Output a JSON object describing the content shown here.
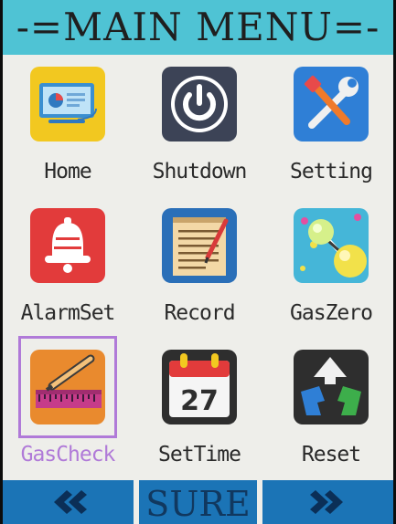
{
  "title": "-=MAIN MENU=-",
  "menu": {
    "items": [
      {
        "label": "Home",
        "icon": "monitor-icon"
      },
      {
        "label": "Shutdown",
        "icon": "power-icon"
      },
      {
        "label": "Setting",
        "icon": "tools-icon"
      },
      {
        "label": "AlarmSet",
        "icon": "bell-icon"
      },
      {
        "label": "Record",
        "icon": "notepad-icon"
      },
      {
        "label": "GasZero",
        "icon": "molecule-icon"
      },
      {
        "label": "GasCheck",
        "icon": "pencil-ruler-icon",
        "selected": true
      },
      {
        "label": "SetTime",
        "icon": "calendar-icon",
        "calendar_day": "27"
      },
      {
        "label": "Reset",
        "icon": "recycle-icon"
      }
    ]
  },
  "bottom_bar": {
    "prev": "«",
    "confirm": "SURE",
    "next": "»"
  },
  "colors": {
    "title_bar": "#4fc3d4",
    "screen_bg": "#eeeeea",
    "button_bg": "#1b74b6",
    "selected_outline": "#b07ad8"
  }
}
